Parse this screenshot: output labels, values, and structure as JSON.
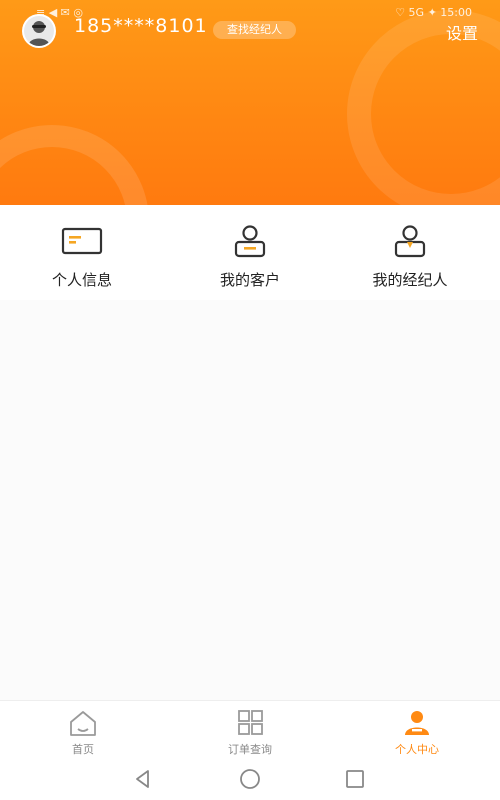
{
  "status_bar": {
    "left_text": "≡ ◀ ✉ ◎",
    "right_text": "♡ 5G ✦ 15:00"
  },
  "header": {
    "phone_number": "185****8101",
    "switch_button_label": "查找经纪人",
    "settings_label": "设置",
    "gradient_colors": [
      "#ff9a17",
      "#ff7a0f"
    ]
  },
  "menu": {
    "items": [
      {
        "label": "个人信息",
        "icon": "id-card-icon"
      },
      {
        "label": "我的客户",
        "icon": "customer-icon"
      },
      {
        "label": "我的经纪人",
        "icon": "agent-icon"
      }
    ]
  },
  "tabbar": {
    "items": [
      {
        "label": "首页",
        "icon": "home-icon",
        "active": false
      },
      {
        "label": "订单查询",
        "icon": "grid-icon",
        "active": false
      },
      {
        "label": "个人中心",
        "icon": "person-icon",
        "active": true
      }
    ],
    "active_color": "#ff8a13",
    "inactive_color": "#8a8a8a"
  },
  "accent_color": "#f5a623"
}
